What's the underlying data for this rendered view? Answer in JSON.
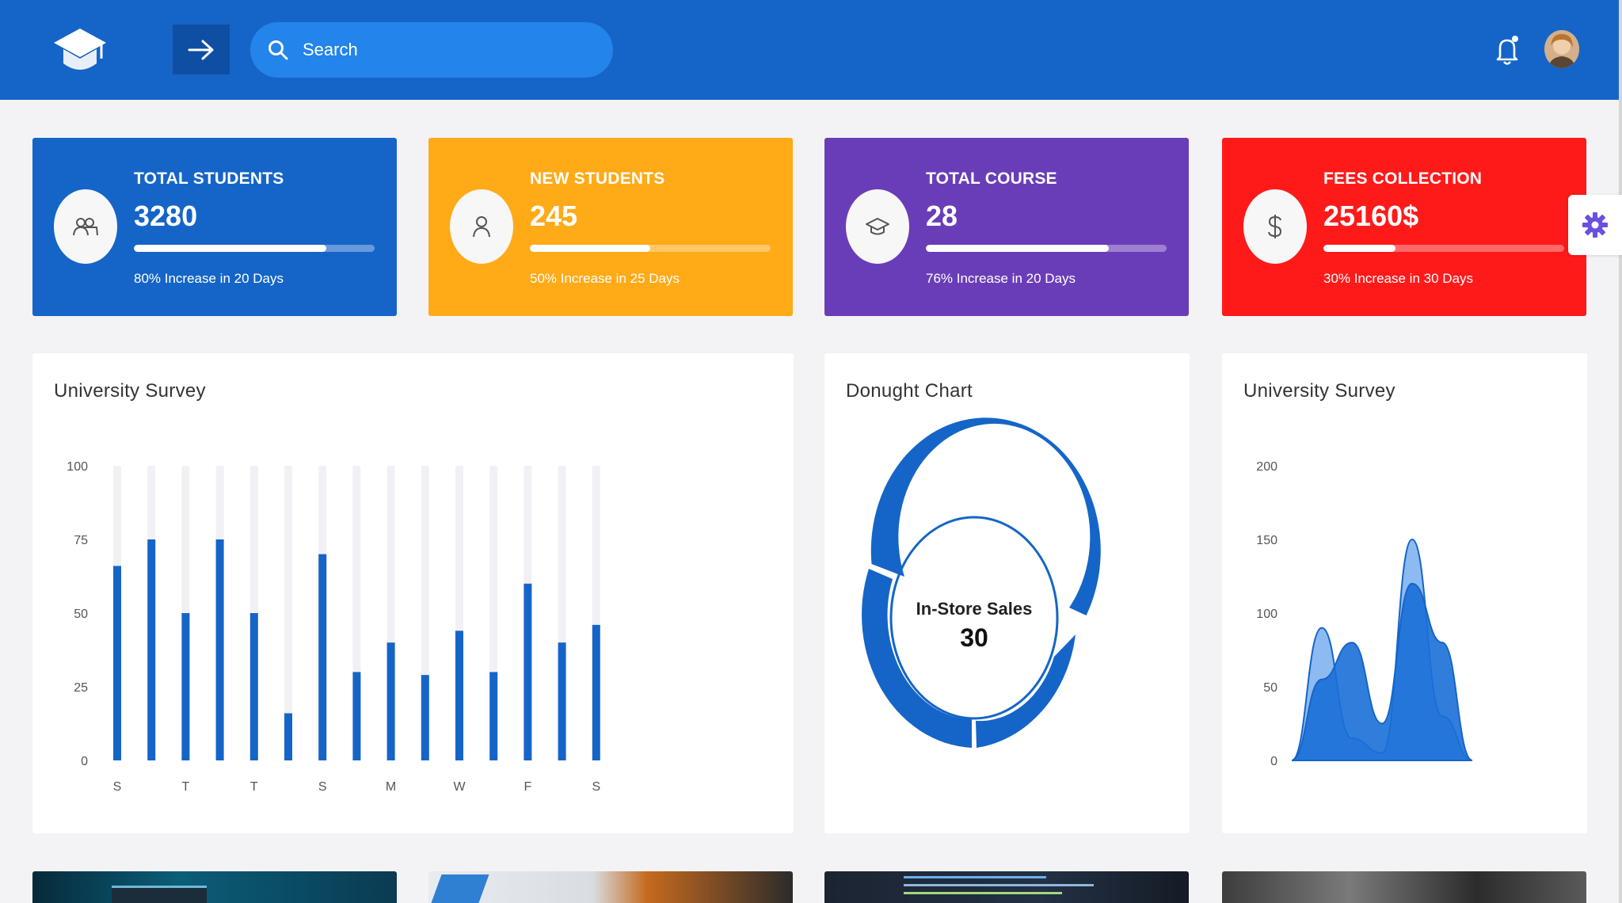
{
  "header": {
    "search_placeholder": "Search"
  },
  "stats": [
    {
      "title": "TOTAL STUDENTS",
      "value": "3280",
      "progress": 0.8,
      "note": "80% Increase in 20 Days",
      "color": "#1565c8",
      "icon": "users-icon"
    },
    {
      "title": "NEW STUDENTS",
      "value": "245",
      "progress": 0.5,
      "note": "50% Increase in 25 Days",
      "color": "#ffaa17",
      "icon": "user-icon"
    },
    {
      "title": "TOTAL COURSE",
      "value": "28",
      "progress": 0.76,
      "note": "76% Increase in 20 Days",
      "color": "#6a3db8",
      "icon": "graduation-cap-icon"
    },
    {
      "title": "FEES COLLECTION",
      "value": "25160$",
      "progress": 0.3,
      "note": "30% Increase in 30 Days",
      "color": "#ff1a1a",
      "icon": "dollar-icon"
    }
  ],
  "cards": {
    "bar_title": "University Survey",
    "donut_title": "Donught Chart",
    "area_title": "University Survey"
  },
  "chart_data": [
    {
      "type": "bar",
      "title": "University Survey",
      "ylim": [
        0,
        100
      ],
      "yticks": [
        0,
        25,
        50,
        75,
        100
      ],
      "xtick_labels": [
        "S",
        "T",
        "T",
        "S",
        "M",
        "W",
        "F",
        "S"
      ],
      "values": [
        66,
        75,
        50,
        75,
        50,
        16,
        70,
        30,
        40,
        29,
        44,
        30,
        60,
        40,
        46
      ],
      "color": "#1565c8",
      "track_color": "#f1f1f5"
    },
    {
      "type": "pie",
      "title": "Donught Chart",
      "center_label": "In-Store Sales",
      "center_value": "30",
      "color": "#1565c8"
    },
    {
      "type": "area",
      "title": "University Survey",
      "ylim": [
        0,
        200
      ],
      "yticks": [
        0,
        50,
        100,
        150,
        200
      ],
      "series": [
        {
          "color": "#7aaef0",
          "values": [
            0,
            90,
            15,
            5,
            150,
            30,
            0
          ]
        },
        {
          "color": "#1a6fd8",
          "values": [
            0,
            55,
            80,
            25,
            120,
            80,
            0
          ]
        }
      ]
    }
  ]
}
